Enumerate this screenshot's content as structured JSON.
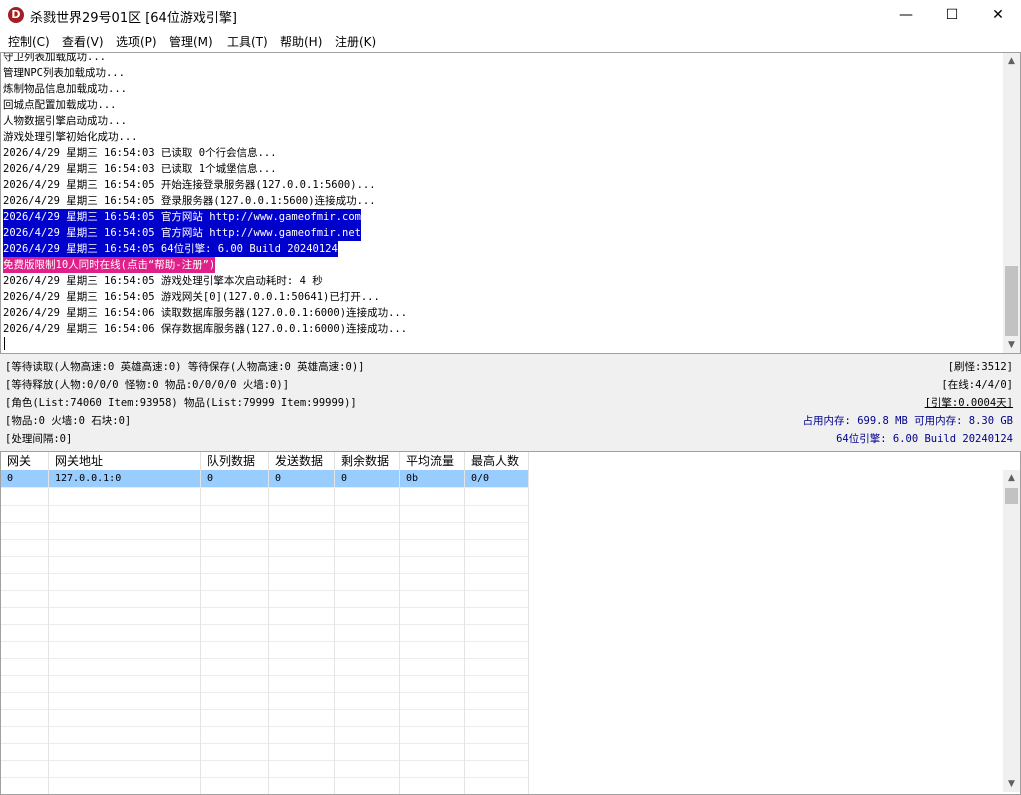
{
  "window": {
    "title": "杀戮世界29号01区 [64位游戏引擎]",
    "icon_letter": "D",
    "minimize": "—",
    "maximize": "☐",
    "close": "✕"
  },
  "menu": [
    "控制(C)",
    "查看(V)",
    "选项(P)",
    "管理(M)",
    "工具(T)",
    "帮助(H)",
    "注册(K)"
  ],
  "log_lines": [
    {
      "text": "守卫列表加载成功...",
      "style": "normal"
    },
    {
      "text": "管理NPC列表加载成功...",
      "style": "normal"
    },
    {
      "text": "炼制物品信息加载成功...",
      "style": "normal"
    },
    {
      "text": "回城点配置加载成功...",
      "style": "normal"
    },
    {
      "text": "人物数据引擎启动成功...",
      "style": "normal"
    },
    {
      "text": "游戏处理引擎初始化成功...",
      "style": "normal"
    },
    {
      "text": "2026/4/29 星期三 16:54:03 已读取 0个行会信息...",
      "style": "normal"
    },
    {
      "text": "2026/4/29 星期三 16:54:03 已读取 1个城堡信息...",
      "style": "normal"
    },
    {
      "text": "2026/4/29 星期三 16:54:05 开始连接登录服务器(127.0.0.1:5600)...",
      "style": "normal"
    },
    {
      "text": "2026/4/29 星期三 16:54:05 登录服务器(127.0.0.1:5600)连接成功...",
      "style": "normal"
    },
    {
      "text": "2026/4/29 星期三 16:54:05 官方网站 http://www.gameofmir.com",
      "style": "blue"
    },
    {
      "text": "2026/4/29 星期三 16:54:05 官方网站 http://www.gameofmir.net",
      "style": "blue"
    },
    {
      "text": "2026/4/29 星期三 16:54:05 64位引擎: 6.00 Build 20240124",
      "style": "blue"
    },
    {
      "text": "免费版限制10人同时在线(点击“帮助-注册”)",
      "style": "pink"
    },
    {
      "text": "2026/4/29 星期三 16:54:05 游戏处理引擎本次启动耗时: 4 秒",
      "style": "normal"
    },
    {
      "text": "2026/4/29 星期三 16:54:05 游戏网关[0](127.0.0.1:50641)已打开...",
      "style": "normal"
    },
    {
      "text": "2026/4/29 星期三 16:54:06 读取数据库服务器(127.0.0.1:6000)连接成功...",
      "style": "normal"
    },
    {
      "text": "2026/4/29 星期三 16:54:06 保存数据库服务器(127.0.0.1:6000)连接成功...",
      "style": "normal"
    }
  ],
  "status": {
    "left": [
      "[等待读取(人物高速:0 英雄高速:0) 等待保存(人物高速:0 英雄高速:0)]",
      "[等待释放(人物:0/0/0 怪物:0 物品:0/0/0/0 火墙:0)]",
      "[角色(List:74060 Item:93958) 物品(List:79999 Item:99999)]",
      "[物品:0 火墙:0 石块:0]",
      "[处理间隔:0]"
    ],
    "right": [
      "[刷怪:3512]",
      "[在线:4/4/0]",
      "[引擎:0.0004天]",
      "占用内存: 699.8 MB 可用内存: 8.30 GB",
      "64位引擎: 6.00 Build 20240124"
    ]
  },
  "gateway_table": {
    "columns": [
      "网关",
      "网关地址",
      "队列数据",
      "发送数据",
      "剩余数据",
      "平均流量",
      "最高人数"
    ],
    "rows": [
      [
        "0",
        "127.0.0.1:0",
        "0",
        "0",
        "0",
        "0b",
        "0/0"
      ]
    ]
  },
  "colors": {
    "log_highlight_blue": "#0000cc",
    "log_highlight_pink": "#e0208a",
    "selected_row": "#99ccff",
    "memory_text": "#00008b"
  }
}
